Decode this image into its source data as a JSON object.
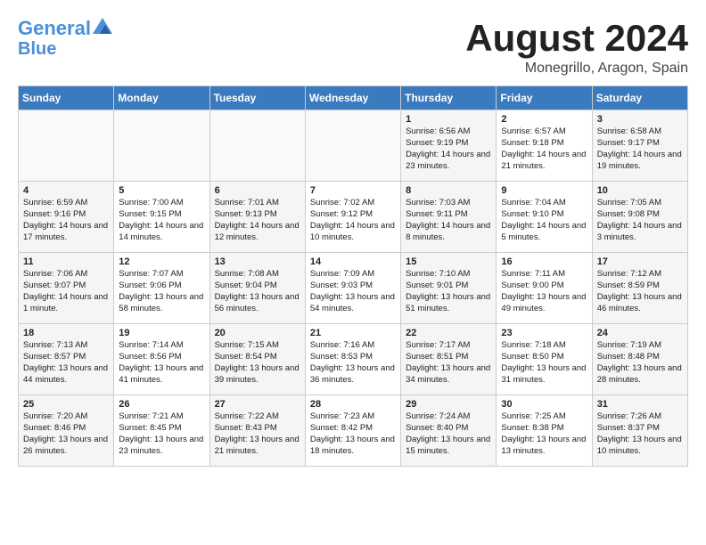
{
  "header": {
    "logo_line1": "General",
    "logo_line2": "Blue",
    "month_year": "August 2024",
    "location": "Monegrillo, Aragon, Spain"
  },
  "weekdays": [
    "Sunday",
    "Monday",
    "Tuesday",
    "Wednesday",
    "Thursday",
    "Friday",
    "Saturday"
  ],
  "weeks": [
    [
      {
        "day": "",
        "info": ""
      },
      {
        "day": "",
        "info": ""
      },
      {
        "day": "",
        "info": ""
      },
      {
        "day": "",
        "info": ""
      },
      {
        "day": "1",
        "info": "Sunrise: 6:56 AM\nSunset: 9:19 PM\nDaylight: 14 hours and 23 minutes."
      },
      {
        "day": "2",
        "info": "Sunrise: 6:57 AM\nSunset: 9:18 PM\nDaylight: 14 hours and 21 minutes."
      },
      {
        "day": "3",
        "info": "Sunrise: 6:58 AM\nSunset: 9:17 PM\nDaylight: 14 hours and 19 minutes."
      }
    ],
    [
      {
        "day": "4",
        "info": "Sunrise: 6:59 AM\nSunset: 9:16 PM\nDaylight: 14 hours and 17 minutes."
      },
      {
        "day": "5",
        "info": "Sunrise: 7:00 AM\nSunset: 9:15 PM\nDaylight: 14 hours and 14 minutes."
      },
      {
        "day": "6",
        "info": "Sunrise: 7:01 AM\nSunset: 9:13 PM\nDaylight: 14 hours and 12 minutes."
      },
      {
        "day": "7",
        "info": "Sunrise: 7:02 AM\nSunset: 9:12 PM\nDaylight: 14 hours and 10 minutes."
      },
      {
        "day": "8",
        "info": "Sunrise: 7:03 AM\nSunset: 9:11 PM\nDaylight: 14 hours and 8 minutes."
      },
      {
        "day": "9",
        "info": "Sunrise: 7:04 AM\nSunset: 9:10 PM\nDaylight: 14 hours and 5 minutes."
      },
      {
        "day": "10",
        "info": "Sunrise: 7:05 AM\nSunset: 9:08 PM\nDaylight: 14 hours and 3 minutes."
      }
    ],
    [
      {
        "day": "11",
        "info": "Sunrise: 7:06 AM\nSunset: 9:07 PM\nDaylight: 14 hours and 1 minute."
      },
      {
        "day": "12",
        "info": "Sunrise: 7:07 AM\nSunset: 9:06 PM\nDaylight: 13 hours and 58 minutes."
      },
      {
        "day": "13",
        "info": "Sunrise: 7:08 AM\nSunset: 9:04 PM\nDaylight: 13 hours and 56 minutes."
      },
      {
        "day": "14",
        "info": "Sunrise: 7:09 AM\nSunset: 9:03 PM\nDaylight: 13 hours and 54 minutes."
      },
      {
        "day": "15",
        "info": "Sunrise: 7:10 AM\nSunset: 9:01 PM\nDaylight: 13 hours and 51 minutes."
      },
      {
        "day": "16",
        "info": "Sunrise: 7:11 AM\nSunset: 9:00 PM\nDaylight: 13 hours and 49 minutes."
      },
      {
        "day": "17",
        "info": "Sunrise: 7:12 AM\nSunset: 8:59 PM\nDaylight: 13 hours and 46 minutes."
      }
    ],
    [
      {
        "day": "18",
        "info": "Sunrise: 7:13 AM\nSunset: 8:57 PM\nDaylight: 13 hours and 44 minutes."
      },
      {
        "day": "19",
        "info": "Sunrise: 7:14 AM\nSunset: 8:56 PM\nDaylight: 13 hours and 41 minutes."
      },
      {
        "day": "20",
        "info": "Sunrise: 7:15 AM\nSunset: 8:54 PM\nDaylight: 13 hours and 39 minutes."
      },
      {
        "day": "21",
        "info": "Sunrise: 7:16 AM\nSunset: 8:53 PM\nDaylight: 13 hours and 36 minutes."
      },
      {
        "day": "22",
        "info": "Sunrise: 7:17 AM\nSunset: 8:51 PM\nDaylight: 13 hours and 34 minutes."
      },
      {
        "day": "23",
        "info": "Sunrise: 7:18 AM\nSunset: 8:50 PM\nDaylight: 13 hours and 31 minutes."
      },
      {
        "day": "24",
        "info": "Sunrise: 7:19 AM\nSunset: 8:48 PM\nDaylight: 13 hours and 28 minutes."
      }
    ],
    [
      {
        "day": "25",
        "info": "Sunrise: 7:20 AM\nSunset: 8:46 PM\nDaylight: 13 hours and 26 minutes."
      },
      {
        "day": "26",
        "info": "Sunrise: 7:21 AM\nSunset: 8:45 PM\nDaylight: 13 hours and 23 minutes."
      },
      {
        "day": "27",
        "info": "Sunrise: 7:22 AM\nSunset: 8:43 PM\nDaylight: 13 hours and 21 minutes."
      },
      {
        "day": "28",
        "info": "Sunrise: 7:23 AM\nSunset: 8:42 PM\nDaylight: 13 hours and 18 minutes."
      },
      {
        "day": "29",
        "info": "Sunrise: 7:24 AM\nSunset: 8:40 PM\nDaylight: 13 hours and 15 minutes."
      },
      {
        "day": "30",
        "info": "Sunrise: 7:25 AM\nSunset: 8:38 PM\nDaylight: 13 hours and 13 minutes."
      },
      {
        "day": "31",
        "info": "Sunrise: 7:26 AM\nSunset: 8:37 PM\nDaylight: 13 hours and 10 minutes."
      }
    ]
  ]
}
